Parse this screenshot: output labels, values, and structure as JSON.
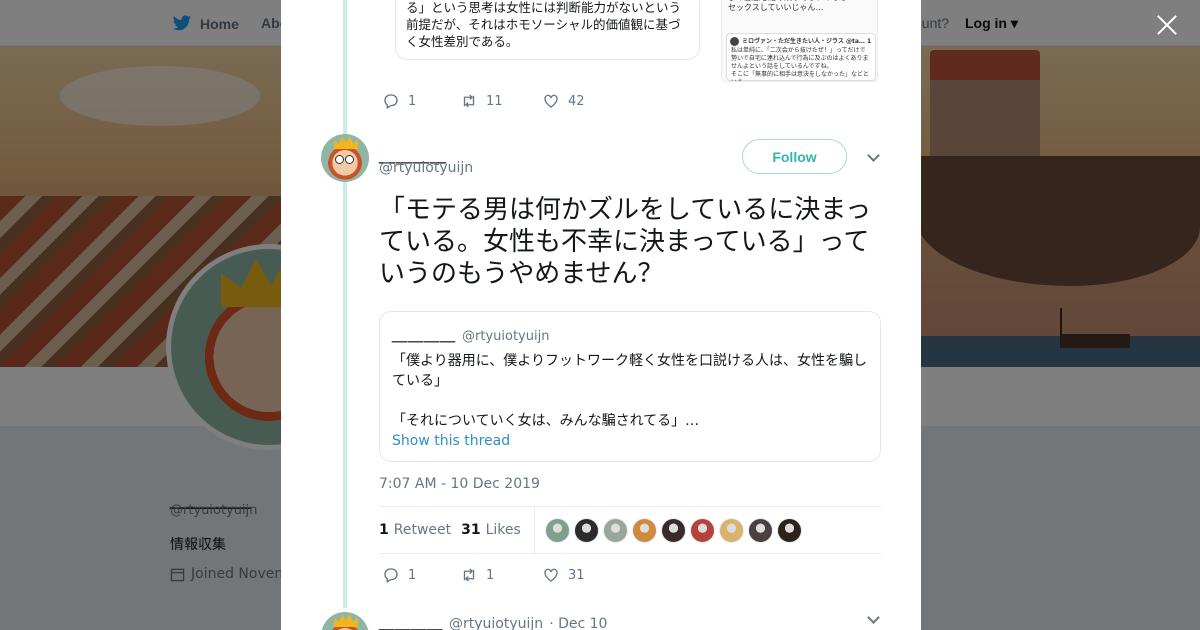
{
  "nav": {
    "home": "Home",
    "about": "Abo",
    "account_prompt": "ccount?",
    "login": "Log in"
  },
  "profile": {
    "name": "＿＿＿＿",
    "handle": "@rtyuiotyuijn",
    "bio": "情報収集",
    "joined": "Joined Novem"
  },
  "previous_tweet": {
    "quote_text": "る」という思考は女性には判断能力がないという前提だが、それはホモソーシャル的価値観に基づく女性差別である。",
    "image_text_top": "子の意志を踏み躙ってないのなら\nセックスしていいじゃん…",
    "image_inner_head": "ミロヴァン・ただ生きたい人・ジラス @ta… 1日",
    "image_inner_text": "私は単純に、「二次会から抜けたぜ！」ってだけで勢いで自宅に連れ込んで行為に及ぶのはよくありませんよという話をしているんですね。\nそこに「無事的に相手は意決をしなかった」などという",
    "replies": "1",
    "retweets": "11",
    "likes": "42"
  },
  "tweet": {
    "name": "＿＿＿＿",
    "handle": "@rtyuiotyuijn",
    "follow_label": "Follow",
    "text": "「モテる男は何かズルをしているに決まっている。女性も不幸に決まっている」っていうのもうやめません？",
    "quote": {
      "name": "＿＿＿＿",
      "handle": "@rtyuiotyuijn",
      "line1": "「僕より器用に、僕よりフットワーク軽く女性を口説ける人は、女性を騙している」",
      "line2": "",
      "line3": "「それについていく女は、みんな騙されてる」…",
      "show_thread": "Show this thread"
    },
    "timestamp": "7:07 AM - 10 Dec 2019",
    "retweet_count": "1",
    "retweet_label": "Retweet",
    "like_count": "31",
    "like_label": "Likes",
    "likers": [
      "#7fa08a",
      "#2b2b2b",
      "#9aa69a",
      "#d08a3c",
      "#3a2a2a",
      "#b4443a",
      "#d9b36a",
      "#4a4040",
      "#2d2418"
    ],
    "replies": "1",
    "retweets": "1",
    "likes": "31"
  },
  "next_tweet": {
    "name": "＿＿＿＿",
    "handle": "@rtyuiotyuijn",
    "date": "· Dec 10"
  }
}
